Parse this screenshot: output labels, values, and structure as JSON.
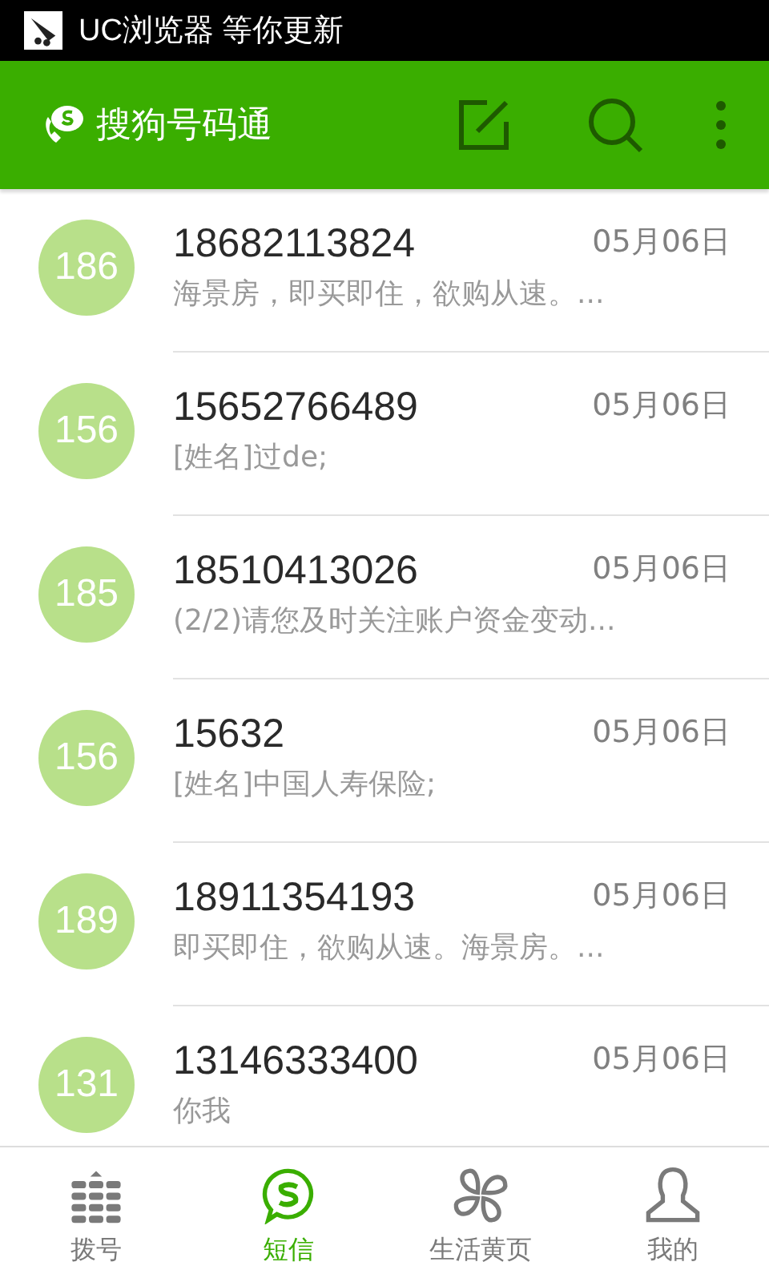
{
  "status_bar": {
    "notification": "UC浏览器 等你更新"
  },
  "header": {
    "title": "搜狗号码通"
  },
  "messages": [
    {
      "avatar": "186",
      "sender": "18682113824",
      "date": "05月06日",
      "preview": "海景房，即买即住，欲购从速。..."
    },
    {
      "avatar": "156",
      "sender": "15652766489",
      "date": "05月06日",
      "preview": "[姓名]过de;"
    },
    {
      "avatar": "185",
      "sender": "18510413026",
      "date": "05月06日",
      "preview": "(2/2)请您及时关注账户资金变动..."
    },
    {
      "avatar": "156",
      "sender": "15632",
      "date": "05月06日",
      "preview": "[姓名]中国人寿保险;"
    },
    {
      "avatar": "189",
      "sender": "18911354193",
      "date": "05月06日",
      "preview": "即买即住，欲购从速。海景房。..."
    },
    {
      "avatar": "131",
      "sender": "13146333400",
      "date": "05月06日",
      "preview": "你我"
    }
  ],
  "tabs": [
    {
      "kind": "dialpad",
      "label": "拨号",
      "selected": false
    },
    {
      "kind": "sms",
      "label": "短信",
      "selected": true
    },
    {
      "kind": "clover",
      "label": "生活黄页",
      "selected": false
    },
    {
      "kind": "person",
      "label": "我的",
      "selected": false
    }
  ]
}
